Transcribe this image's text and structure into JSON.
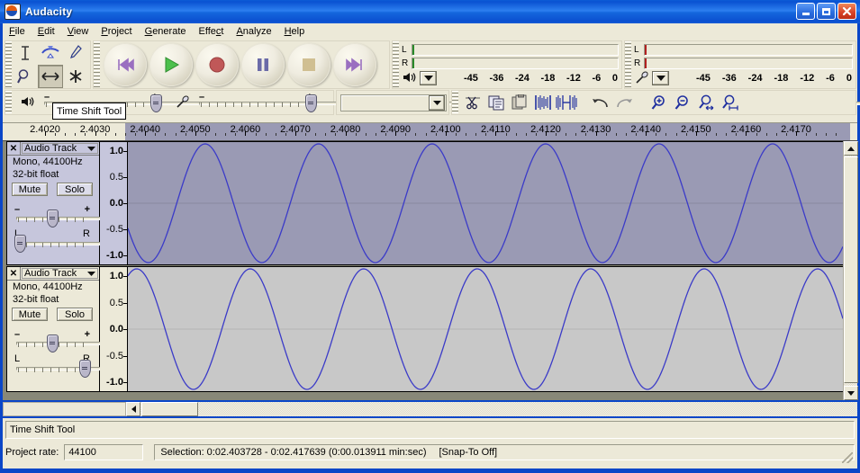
{
  "window": {
    "title": "Audacity",
    "icon": "audacity-logo-icon",
    "minimize_label": "_",
    "maximize_label": "□",
    "close_label": "✕"
  },
  "menu": {
    "items": [
      {
        "label": "File"
      },
      {
        "label": "Edit"
      },
      {
        "label": "View"
      },
      {
        "label": "Project"
      },
      {
        "label": "Generate"
      },
      {
        "label": "Effect"
      },
      {
        "label": "Analyze"
      },
      {
        "label": "Help"
      }
    ]
  },
  "tools_toolbar": {
    "buttons": [
      {
        "name": "selection-tool",
        "icon": "i-beam-icon",
        "selected": false
      },
      {
        "name": "envelope-tool",
        "icon": "envelope-icon",
        "selected": false
      },
      {
        "name": "draw-tool",
        "icon": "pencil-icon",
        "selected": false
      },
      {
        "name": "zoom-tool",
        "icon": "magnifier-icon",
        "selected": false
      },
      {
        "name": "timeshift-tool",
        "icon": "left-right-arrow-icon",
        "selected": true
      },
      {
        "name": "multi-tool",
        "icon": "asterisk-icon",
        "selected": false
      }
    ]
  },
  "transport_toolbar": {
    "buttons": [
      {
        "name": "skip-to-start-button",
        "icon": "skip-start-icon"
      },
      {
        "name": "play-button",
        "icon": "play-icon"
      },
      {
        "name": "record-button",
        "icon": "record-icon"
      },
      {
        "name": "pause-button",
        "icon": "pause-icon"
      },
      {
        "name": "stop-button",
        "icon": "stop-icon"
      },
      {
        "name": "skip-to-end-button",
        "icon": "skip-end-icon"
      }
    ]
  },
  "meters": {
    "output": {
      "icon": "speaker-icon",
      "left_label": "L",
      "right_label": "R",
      "scale": [
        "-45",
        "-36",
        "-24",
        "-18",
        "-12",
        "-6",
        "0"
      ],
      "level_color": "#2a8a2a"
    },
    "input": {
      "icon": "microphone-icon",
      "left_label": "L",
      "right_label": "R",
      "scale": [
        "-45",
        "-36",
        "-24",
        "-18",
        "-12",
        "-6",
        "0"
      ],
      "level_color": "#b02020"
    }
  },
  "mixer_toolbar": {
    "output_volume": {
      "icon": "speaker-icon",
      "minus": "–",
      "plus": "+",
      "value_pct": 92
    },
    "input_volume": {
      "icon": "microphone-icon",
      "minus": "–",
      "plus": "+",
      "value_pct": 92
    }
  },
  "selbox_toolbar": {
    "value": "",
    "dropdown_icon": "chevron-down-icon"
  },
  "edit_toolbar": {
    "buttons": [
      {
        "name": "cut-button",
        "icon": "scissors-icon"
      },
      {
        "name": "copy-button",
        "icon": "copy-icon"
      },
      {
        "name": "paste-button",
        "icon": "clipboard-icon"
      },
      {
        "name": "trim-button",
        "icon": "trim-outside-icon"
      },
      {
        "name": "silence-button",
        "icon": "silence-selection-icon"
      },
      {
        "name": "undo-button",
        "icon": "undo-arrow-icon"
      },
      {
        "name": "redo-button",
        "icon": "redo-arrow-icon"
      },
      {
        "name": "zoom-in-button",
        "icon": "zoom-in-icon"
      },
      {
        "name": "zoom-out-button",
        "icon": "zoom-out-icon"
      },
      {
        "name": "fit-selection-button",
        "icon": "fit-selection-icon"
      },
      {
        "name": "fit-project-button",
        "icon": "fit-project-icon"
      }
    ]
  },
  "tooltip": {
    "text": "Time Shift Tool"
  },
  "timeline": {
    "labels": [
      "2.4020",
      "2.4030",
      "2.4040",
      "2.4050",
      "2.4060",
      "2.4070",
      "2.4080",
      "2.4090",
      "2.4100",
      "2.4110",
      "2.4120",
      "2.4130",
      "2.4140",
      "2.4150",
      "2.4160",
      "2.4170"
    ],
    "selection_start_label": "2.4040",
    "selection_color": "#9a9ab4"
  },
  "tracks": [
    {
      "name": "Audio Track",
      "channels": "Mono, 44100Hz",
      "format": "32-bit float",
      "mute_label": "Mute",
      "solo_label": "Solo",
      "close_label": "✕",
      "menu_icon": "track-dropdown-icon",
      "gain": {
        "minus": "–",
        "plus": "+",
        "position_pct": 50
      },
      "pan": {
        "left_label": "L",
        "right_label": "R",
        "position_pct": 0
      },
      "vruler": [
        "1.0",
        "0.5",
        "0.0",
        "-0.5",
        "-1.0"
      ],
      "selected": true,
      "waveform": {
        "type": "sine",
        "cycles": 6.3,
        "phase_deg": 205,
        "amplitude": 1.0,
        "color": "#3b3bc8"
      }
    },
    {
      "name": "Audio Track",
      "channels": "Mono, 44100Hz",
      "format": "32-bit float",
      "mute_label": "Mute",
      "solo_label": "Solo",
      "close_label": "✕",
      "menu_icon": "track-dropdown-icon",
      "gain": {
        "minus": "–",
        "plus": "+",
        "position_pct": 50
      },
      "pan": {
        "left_label": "L",
        "right_label": "R",
        "position_pct": 100
      },
      "vruler": [
        "1.0",
        "0.5",
        "0.0",
        "-0.5",
        "-1.0"
      ],
      "selected": false,
      "waveform": {
        "type": "sine",
        "cycles": 6.3,
        "phase_deg": 62,
        "amplitude": 1.0,
        "color": "#3b3bc8"
      }
    }
  ],
  "scrollbars": {
    "vertical": {
      "up_icon": "triangle-up-icon",
      "down_icon": "triangle-down-icon"
    },
    "horizontal": {
      "left_icon": "triangle-left-icon",
      "right_icon": "triangle-right-icon"
    }
  },
  "status": {
    "message": "Time Shift Tool",
    "project_rate_label": "Project rate:",
    "project_rate_value": "44100",
    "selection_text": "Selection: 0:02.403728 - 0:02.417639 (0:00.013911 min:sec)",
    "snap_to_text": "[Snap-To Off]"
  }
}
